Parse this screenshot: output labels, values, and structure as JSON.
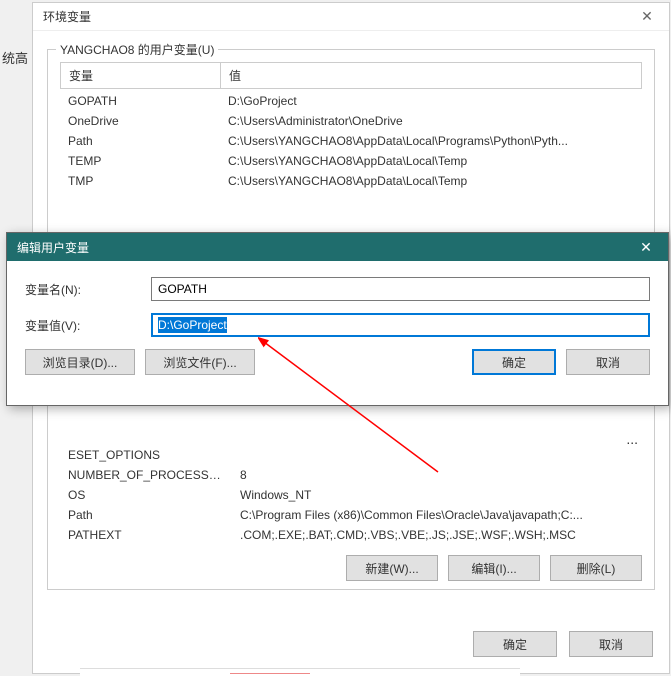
{
  "outerWindow": {
    "title": "环境变量",
    "closeGlyph": "✕"
  },
  "behindFragment": "统高",
  "userGroup": {
    "legend": "YANGCHAO8 的用户变量(U)",
    "headerVar": "变量",
    "headerVal": "值",
    "rows": [
      {
        "var": "GOPATH",
        "val": "D:\\GoProject"
      },
      {
        "var": "OneDrive",
        "val": "C:\\Users\\Administrator\\OneDrive"
      },
      {
        "var": "Path",
        "val": "C:\\Users\\YANGCHAO8\\AppData\\Local\\Programs\\Python\\Pyth..."
      },
      {
        "var": "TEMP",
        "val": "C:\\Users\\YANGCHAO8\\AppData\\Local\\Temp"
      },
      {
        "var": "TMP",
        "val": "C:\\Users\\YANGCHAO8\\AppData\\Local\\Temp"
      }
    ]
  },
  "systemGroup": {
    "moreDots": "...",
    "rows": [
      {
        "var": "ESET_OPTIONS",
        "val": ""
      },
      {
        "var": "NUMBER_OF_PROCESSORS",
        "val": "8"
      },
      {
        "var": "OS",
        "val": "Windows_NT"
      },
      {
        "var": "Path",
        "val": "C:\\Program Files (x86)\\Common Files\\Oracle\\Java\\javapath;C:..."
      },
      {
        "var": "PATHEXT",
        "val": ".COM;.EXE;.BAT;.CMD;.VBS;.VBE;.JS;.JSE;.WSF;.WSH;.MSC"
      }
    ],
    "buttons": {
      "new": "新建(W)...",
      "edit": "编辑(I)...",
      "delete": "删除(L)"
    }
  },
  "outerButtons": {
    "ok": "确定",
    "cancel": "取消"
  },
  "modal": {
    "title": "编辑用户变量",
    "closeGlyph": "✕",
    "nameLabel": "变量名(N):",
    "nameValue": "GOPATH",
    "valueLabel": "变量值(V):",
    "valueValue": "D:\\GoProject",
    "browseDir": "浏览目录(D)...",
    "browseFile": "浏览文件(F)...",
    "ok": "确定",
    "cancel": "取消"
  }
}
